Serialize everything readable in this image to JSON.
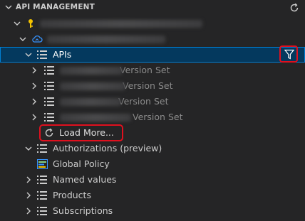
{
  "panel": {
    "title": "API MANAGEMENT",
    "refresh_icon": "refresh-icon"
  },
  "tree": {
    "apis_label": "APIs",
    "api_items": [
      {
        "suffix": "Version Set"
      },
      {
        "suffix": "Version Set"
      },
      {
        "suffix": "Version Set"
      },
      {
        "suffix": "Version Set"
      }
    ],
    "load_more": "Load More...",
    "authorizations": "Authorizations (preview)",
    "global_policy": "Global Policy",
    "named_values": "Named values",
    "products": "Products",
    "subscriptions": "Subscriptions"
  },
  "colors": {
    "background": "#252526",
    "selection": "#04395e",
    "selection_border": "#007fd4",
    "highlight_box": "#e0101e",
    "key_icon": "#f5c400",
    "cloud_icon": "#3794ff"
  }
}
